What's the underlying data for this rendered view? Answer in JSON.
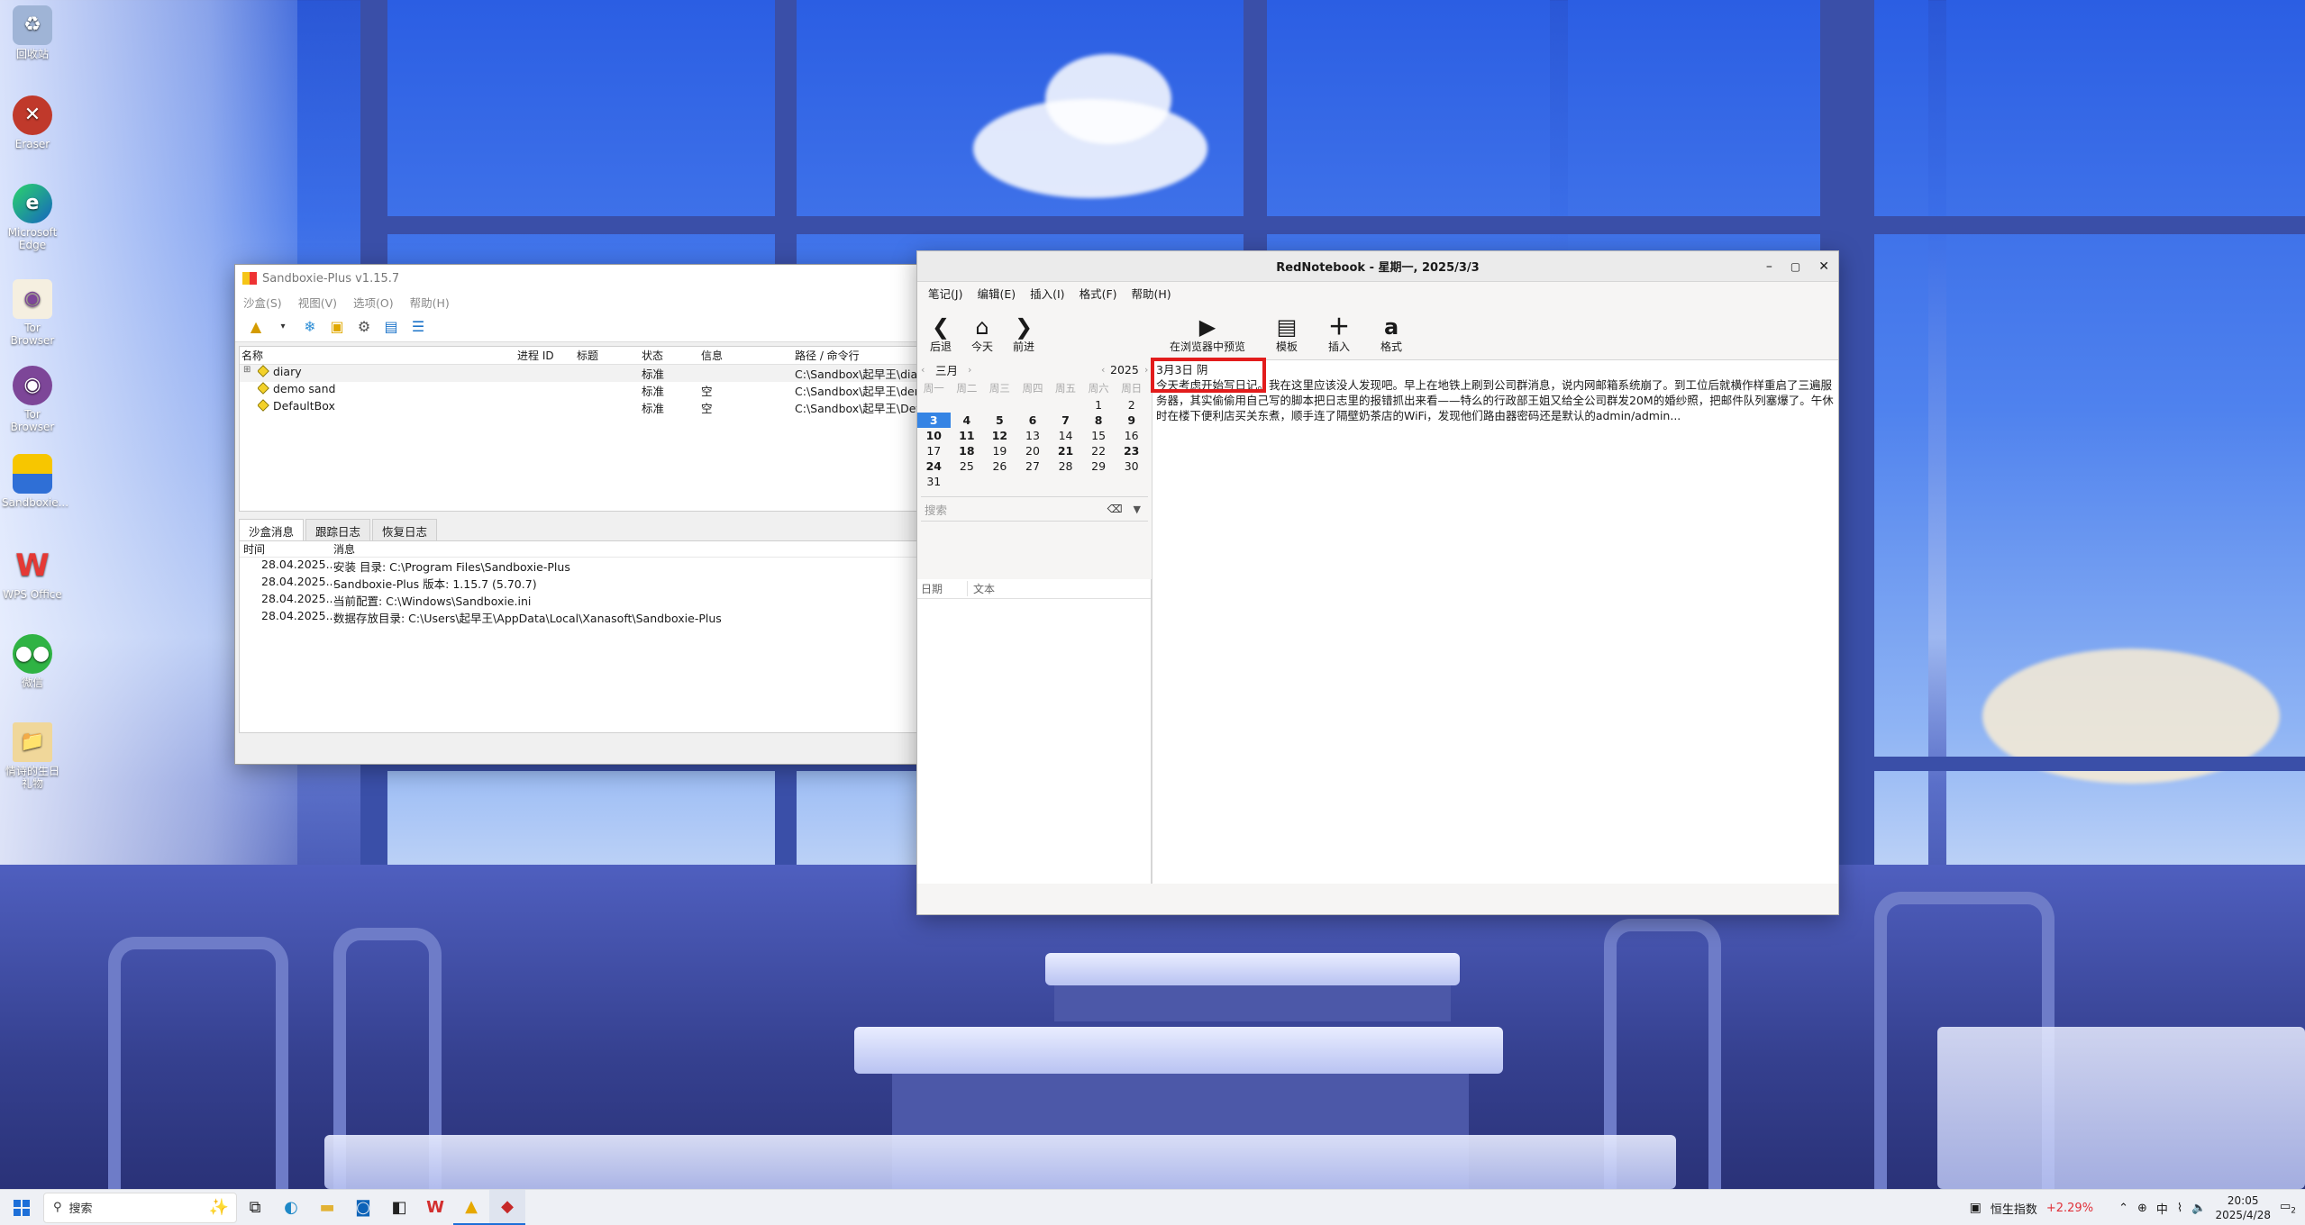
{
  "desktop": {
    "icons": [
      {
        "label": "回收站",
        "icon": "recycle-bin-icon",
        "color": "#8aa3c4"
      },
      {
        "label": "Eraser",
        "icon": "eraser-icon",
        "color": "#c0392b"
      },
      {
        "label": "Microsoft Edge",
        "icon": "edge-icon",
        "color": "#1fa2c9"
      },
      {
        "label": "Tor Browser",
        "icon": "tor-icon",
        "color": "#7d4698"
      },
      {
        "label": "Tor Browser",
        "icon": "tor-icon",
        "color": "#7d4698"
      },
      {
        "label": "Sandboxie...",
        "icon": "sandboxie-icon",
        "color": "#f0b400"
      },
      {
        "label": "WPS Office",
        "icon": "wps-icon",
        "color": "#d32f2f"
      },
      {
        "label": "微信",
        "icon": "wechat-icon",
        "color": "#2fb344"
      },
      {
        "label": "情诗的生日礼物",
        "icon": "folder-icon",
        "color": "#e8c477"
      }
    ]
  },
  "sandboxie": {
    "title": "Sandboxie-Plus v1.15.7",
    "menu": [
      "沙盒(S)",
      "视图(V)",
      "选项(O)",
      "帮助(H)"
    ],
    "columns": [
      "名称",
      "进程 ID",
      "标题",
      "状态",
      "信息",
      "路径 / 命令行"
    ],
    "rows": [
      {
        "name": "diary",
        "status": "标准",
        "info": "",
        "path": "C:\\Sandbox\\起早王\\diary"
      },
      {
        "name": "demo sand",
        "status": "标准",
        "info": "空",
        "path": "C:\\Sandbox\\起早王\\demo"
      },
      {
        "name": "DefaultBox",
        "status": "标准",
        "info": "空",
        "path": "C:\\Sandbox\\起早王\\Defa"
      }
    ],
    "tabs": [
      "沙盒消息",
      "跟踪日志",
      "恢复日志"
    ],
    "log_columns": [
      "时间",
      "消息"
    ],
    "log": [
      {
        "time": "28.04.2025...",
        "msg": "安装 目录: C:\\Program Files\\Sandboxie-Plus"
      },
      {
        "time": "28.04.2025...",
        "msg": "Sandboxie-Plus 版本: 1.15.7 (5.70.7)"
      },
      {
        "time": "28.04.2025...",
        "msg": "当前配置: C:\\Windows\\Sandboxie.ini"
      },
      {
        "time": "28.04.2025...",
        "msg": "数据存放目录: C:\\Users\\起早王\\AppData\\Local\\Xanasoft\\Sandboxie-Plus"
      }
    ]
  },
  "rednotebook": {
    "title": "RedNotebook - 星期一, 2025/3/3",
    "menu": [
      "笔记(J)",
      "编辑(E)",
      "插入(I)",
      "格式(F)",
      "帮助(H)"
    ],
    "nav": [
      {
        "label": "后退",
        "icon": "chevron-left-icon"
      },
      {
        "label": "今天",
        "icon": "home-icon"
      },
      {
        "label": "前进",
        "icon": "chevron-right-icon"
      }
    ],
    "tools": [
      {
        "label": "在浏览器中预览",
        "icon": "play-icon"
      },
      {
        "label": "模板",
        "icon": "clipboard-icon"
      },
      {
        "label": "插入",
        "icon": "plus-icon"
      },
      {
        "label": "格式",
        "icon": "format-icon"
      }
    ],
    "calendar": {
      "month": "三月",
      "year": "2025",
      "weekdays": [
        "周一",
        "周二",
        "周三",
        "周四",
        "周五",
        "周六",
        "周日"
      ],
      "weeks": [
        [
          "",
          "",
          "",
          "",
          "",
          "1",
          "2"
        ],
        [
          "3",
          "4",
          "5",
          "6",
          "7",
          "8",
          "9"
        ],
        [
          "10",
          "11",
          "12",
          "13",
          "14",
          "15",
          "16"
        ],
        [
          "17",
          "18",
          "19",
          "20",
          "21",
          "22",
          "23"
        ],
        [
          "24",
          "25",
          "26",
          "27",
          "28",
          "29",
          "30"
        ],
        [
          "31",
          "",
          "",
          "",
          "",
          "",
          ""
        ]
      ],
      "selected": "3",
      "bold_days": [
        "3",
        "4",
        "5",
        "6",
        "7",
        "8",
        "9",
        "10",
        "11",
        "12",
        "18",
        "21",
        "23",
        "24"
      ]
    },
    "search_placeholder": "搜索",
    "results_columns": [
      "日期",
      "文本"
    ],
    "entry": {
      "heading": "3月3日 阴",
      "text": "今天考虑开始写日记。我在这里应该没人发现吧。早上在地铁上刷到公司群消息，说内网邮箱系统崩了。到工位后就横作样重启了三遍服务器，其实偷偷用自己写的脚本把日志里的报错抓出来看——特么的行政部王姐又给全公司群发20M的婚纱照，把邮件队列塞爆了。午休时在楼下便利店买关东煮，顺手连了隔壁奶茶店的WiFi，发现他们路由器密码还是默认的admin/admin..."
    }
  },
  "taskbar": {
    "search_label": "搜索",
    "stock_name": "恒生指数",
    "stock_change": "+2.29%",
    "ime": "中",
    "time": "20:05",
    "date": "2025/4/28",
    "notify_count": "2"
  },
  "colors": {
    "accent": "#3584e4",
    "highlight": "#e21c1c",
    "stock_up": "#e0313a"
  }
}
